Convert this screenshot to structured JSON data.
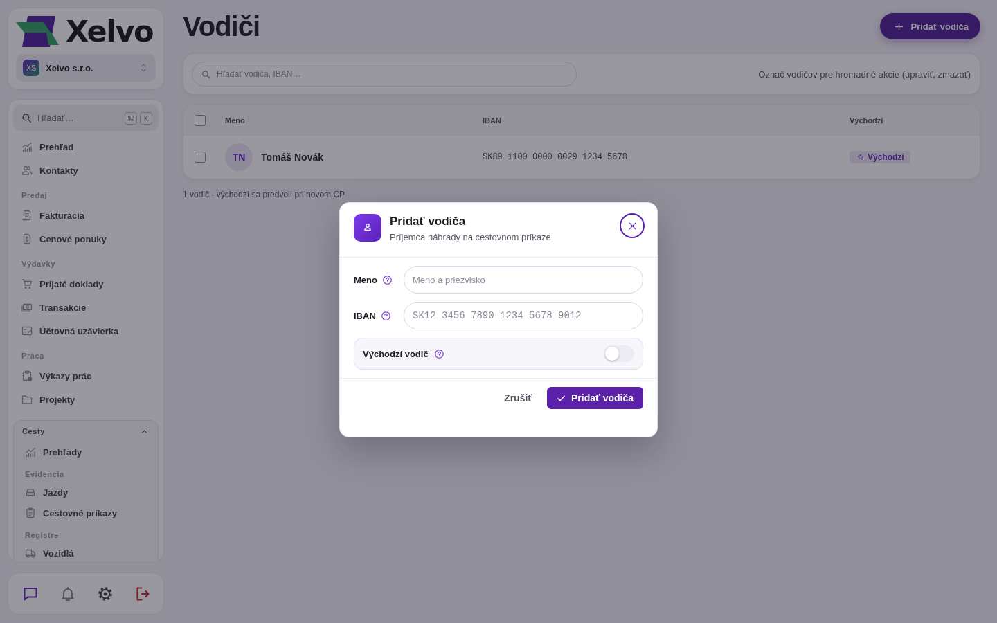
{
  "sidebar": {
    "brand": {
      "name": "Xelvo"
    },
    "workspace": {
      "initials": "XS",
      "name": "Xelvo s.r.o."
    },
    "search": {
      "placeholder": "Hľadať…",
      "keys": [
        "⌘",
        "K"
      ]
    },
    "nav": [
      {
        "kind": "section",
        "items": [
          "Prehľad",
          "Kontakty"
        ]
      },
      {
        "kind": "section",
        "title": "Predaj",
        "items": [
          "Fakturácia",
          "Cenové ponuky"
        ]
      },
      {
        "kind": "section",
        "title": "Výdavky",
        "items": [
          "Prijaté doklady",
          "Transakcie",
          "Účtovná uzávierka"
        ]
      },
      {
        "kind": "section",
        "title": "Práca",
        "items": [
          "Výkazy prác",
          "Projekty"
        ]
      },
      {
        "kind": "group",
        "title": "Cesty",
        "expanded": true,
        "children": [
          {
            "items": [
              "Prehľady"
            ]
          },
          {
            "title": "Evidencia",
            "items": [
              "Jazdy",
              "Cestovné príkazy"
            ]
          },
          {
            "title": "Registre",
            "items": [
              "Vozidlá"
            ]
          }
        ]
      }
    ]
  },
  "page": {
    "title": "Vodiči",
    "add_button": "Pridať vodiča"
  },
  "toolbar": {
    "search": {
      "placeholder": "Hľadať vodiča, IBAN…"
    },
    "hint": "Označ vodičov pre hromadné akcie (upraviť, zmazať)"
  },
  "table": {
    "select_all": {
      "checked": false
    },
    "columns": [
      "Meno",
      "IBAN",
      "Východzí"
    ],
    "rows": [
      {
        "checked": false,
        "initials": "TN",
        "name": "Tomáš Novák",
        "iban": "SK89 1100 0000 0029 1234 5678",
        "default": true,
        "default_label": "Východzí"
      }
    ]
  },
  "footer_note": "1 vodič · východzí sa predvolí pri novom CP",
  "dialog": {
    "title": "Pridať vodiča",
    "subtitle": "Príjemca náhrady na cestovnom príkaze",
    "fields": [
      {
        "kind": "text",
        "label": "Meno",
        "placeholder": "Meno a priezvisko"
      },
      {
        "kind": "iban",
        "label": "IBAN",
        "placeholder": "SK12 3456 7890 1234 5678 9012"
      }
    ],
    "toggle": {
      "label": "Východzí vodič",
      "on": false
    },
    "cancel": "Zrušiť",
    "submit": "Pridať vodiča"
  }
}
